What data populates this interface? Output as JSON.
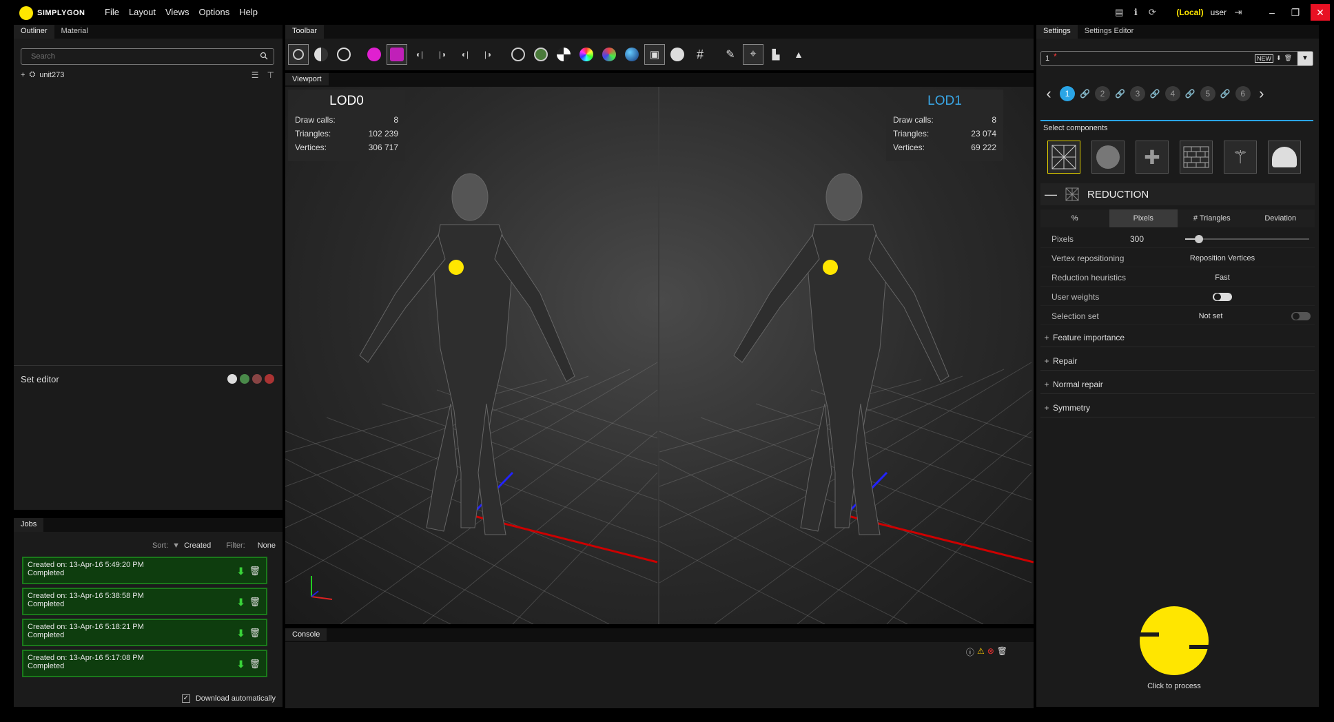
{
  "app": {
    "logo_text": "SIMPLYGON"
  },
  "menu": [
    "File",
    "Layout",
    "Views",
    "Options",
    "Help"
  ],
  "user": {
    "location": "(Local)",
    "name": "user"
  },
  "left": {
    "tabs": [
      "Outliner",
      "Material"
    ],
    "search_placeholder": "Search",
    "tree_item": "unit273",
    "set_editor_title": "Set editor"
  },
  "jobs": {
    "tab": "Jobs",
    "sort_label": "Sort:",
    "sort_value": "Created",
    "filter_label": "Filter:",
    "filter_value": "None",
    "items": [
      {
        "created": "Created on: 13-Apr-16 5:49:20 PM",
        "status": "Completed"
      },
      {
        "created": "Created on: 13-Apr-16 5:38:58 PM",
        "status": "Completed"
      },
      {
        "created": "Created on: 13-Apr-16 5:18:21 PM",
        "status": "Completed"
      },
      {
        "created": "Created on: 13-Apr-16 5:17:08 PM",
        "status": "Completed"
      }
    ],
    "download_auto": "Download automatically"
  },
  "toolbar": {
    "tab": "Toolbar"
  },
  "viewport": {
    "tab": "Viewport",
    "lods": [
      {
        "name": "LOD0",
        "draw_calls_label": "Draw calls:",
        "draw_calls": "8",
        "triangles_label": "Triangles:",
        "triangles": "102 239",
        "vertices_label": "Vertices:",
        "vertices": "306 717"
      },
      {
        "name": "LOD1",
        "draw_calls_label": "Draw calls:",
        "draw_calls": "8",
        "triangles_label": "Triangles:",
        "triangles": "23 074",
        "vertices_label": "Vertices:",
        "vertices": "69 222"
      }
    ]
  },
  "console": {
    "tab": "Console"
  },
  "settings": {
    "tabs": [
      "Settings",
      "Settings Editor"
    ],
    "preset_value": "1",
    "preset_badge": "NEW",
    "steps": [
      "1",
      "2",
      "3",
      "4",
      "5",
      "6"
    ],
    "select_components": "Select components",
    "section": "REDUCTION",
    "modes": [
      "%",
      "Pixels",
      "# Triangles",
      "Deviation"
    ],
    "props": {
      "pixels_label": "Pixels",
      "pixels_value": "300",
      "vertex_label": "Vertex repositioning",
      "vertex_value": "Reposition Vertices",
      "heur_label": "Reduction heuristics",
      "heur_value": "Fast",
      "weights_label": "User weights",
      "selection_label": "Selection set",
      "selection_value": "Not set"
    },
    "collapsed": [
      "Feature importance",
      "Repair",
      "Normal repair",
      "Symmetry"
    ],
    "process_label": "Click to process"
  }
}
